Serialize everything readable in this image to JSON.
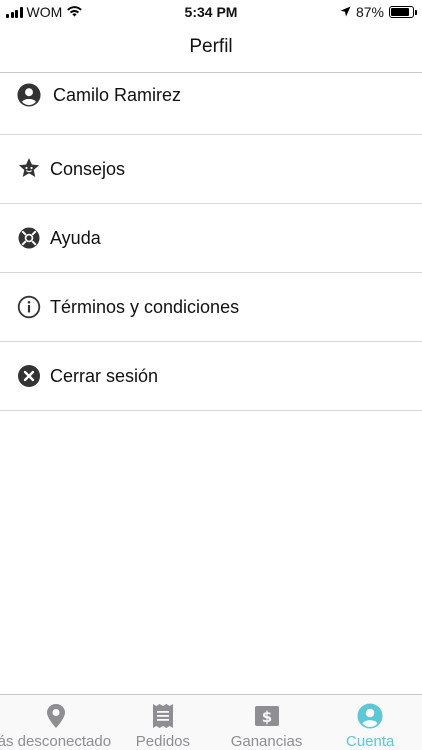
{
  "status_bar": {
    "carrier": "WOM",
    "time": "5:34 PM",
    "battery": "87%"
  },
  "header": {
    "title": "Perfil"
  },
  "menu": {
    "items": [
      {
        "label": "Camilo Ramirez",
        "icon": "user-circle-icon"
      },
      {
        "label": "Consejos",
        "icon": "star-badge-icon"
      },
      {
        "label": "Ayuda",
        "icon": "lifebuoy-icon"
      },
      {
        "label": "Términos y condiciones",
        "icon": "info-icon"
      },
      {
        "label": "Cerrar sesión",
        "icon": "close-circle-icon"
      }
    ]
  },
  "tab_bar": {
    "tabs": [
      {
        "label": "stás desconectado",
        "icon": "location-pin-icon",
        "active": false
      },
      {
        "label": "Pedidos",
        "icon": "receipt-icon",
        "active": false
      },
      {
        "label": "Ganancias",
        "icon": "dollar-icon",
        "active": false
      },
      {
        "label": "Cuenta",
        "icon": "user-circle-icon",
        "active": true
      }
    ],
    "active_color": "#5ac8d8",
    "inactive_color": "#8e8e93"
  }
}
